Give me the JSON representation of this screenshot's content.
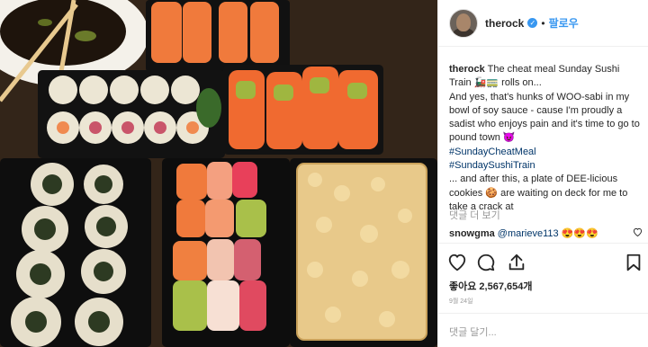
{
  "post": {
    "username": "therock",
    "follow_label": "팔로우",
    "separator": "•",
    "caption_user": "therock",
    "caption_line1": "The cheat meal Sunday Sushi Train 🚂🚃 rolls on...",
    "caption_line2": "And yes, that's hunks of WOO-sabi in my bowl of soy sauce - cause I'm proudly a sadist who enjoys pain and it's time to go to pound town 😈",
    "hashtag1": "#SundayCheatMeal",
    "hashtag2": "#SundaySushiTrain",
    "caption_line3": "... and after this, a plate of DEE-licious cookies 🍪 are waiting on deck for me to take a crack at",
    "more_comments": "댓글 더 보기",
    "comment_user": "snowgma",
    "comment_mention": "@marieve113",
    "comment_text": "😍😍😍",
    "likes": "좋아요 2,567,654개",
    "date": "9월 24일",
    "add_comment_placeholder": "댓글 달기..."
  },
  "colors": {
    "link": "#003569",
    "accent": "#3897f0",
    "muted": "#999999"
  },
  "icons": [
    "heart-icon",
    "comment-icon",
    "share-icon",
    "bookmark-icon"
  ]
}
